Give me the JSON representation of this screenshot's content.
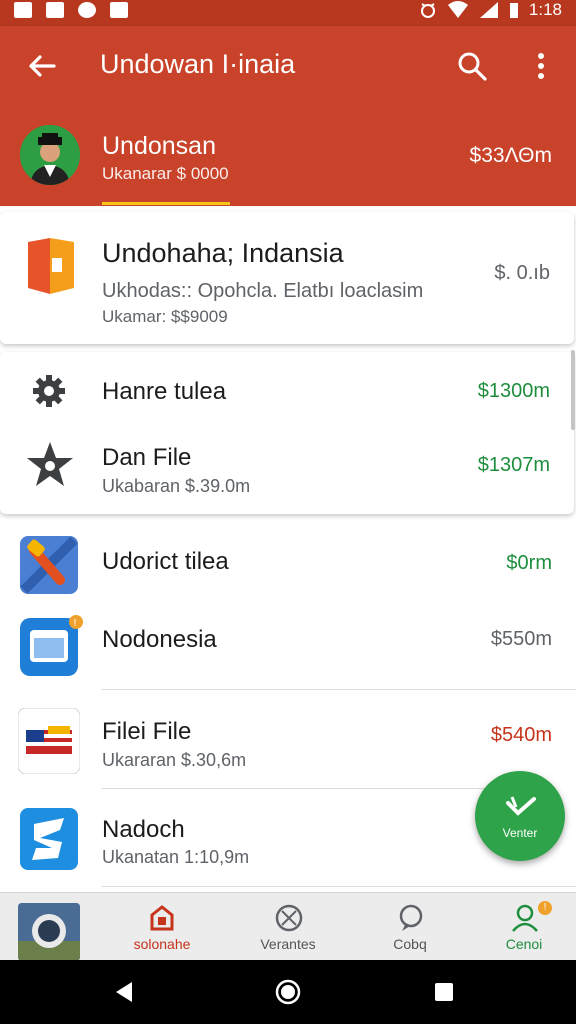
{
  "status_bar": {
    "time": "1:18"
  },
  "app_bar": {
    "title": "Undowan I·inaia"
  },
  "account": {
    "name": "Undonsan",
    "subtitle": "Ukanarar $ 0000",
    "amount": "$33ΛΘm"
  },
  "card_featured": {
    "title": "Undohaha; Indansia",
    "subtitle": "Ukhodas:: Opohcla. Elatbı loaclasim",
    "detail": "Ukamar: $$9009",
    "amount": "$. 0.ıb"
  },
  "card_list": [
    {
      "title": "Hanre tulea",
      "subtitle": "",
      "amount": "$1300m",
      "icon": "gear-icon"
    },
    {
      "title": "Dan File",
      "subtitle": "Ukabaran $.39.0m",
      "amount": "$1307m",
      "icon": "star-icon"
    }
  ],
  "list": [
    {
      "title": "Udorict tilea",
      "subtitle": "",
      "amount": "$0rm",
      "amount_color": "#1e8e3e",
      "icon": "hammer-app-icon"
    },
    {
      "title": "Nodonesia",
      "subtitle": "",
      "amount": "$550m",
      "amount_color": "#5f6368",
      "icon": "window-app-icon",
      "badge": "!"
    },
    {
      "title": "Filei File",
      "subtitle": "Ukararan $.30,6m",
      "amount": "$540m",
      "amount_color": "#c5341b",
      "icon": "flag-app-icon"
    },
    {
      "title": "Nadoch",
      "subtitle": "Ukanatan 1:10,9m",
      "amount": "",
      "amount_color": "#5f6368",
      "icon": "s-app-icon"
    }
  ],
  "fab": {
    "label": "Venter"
  },
  "bottom_nav": [
    {
      "label": "",
      "icon": "photo-thumbnail"
    },
    {
      "label": "solonahe",
      "icon": "home-icon",
      "active": true,
      "color": "#c5341b"
    },
    {
      "label": "Verantes",
      "icon": "compass-icon"
    },
    {
      "label": "Cobq",
      "icon": "chat-icon"
    },
    {
      "label": "Cenoi",
      "icon": "person-icon",
      "color": "#1e8e3e",
      "badge": "!"
    }
  ],
  "colors": {
    "primary": "#c8432a",
    "primary_dark": "#b7381f",
    "accent_green": "#1e8e3e",
    "fab": "#2fa34a"
  }
}
